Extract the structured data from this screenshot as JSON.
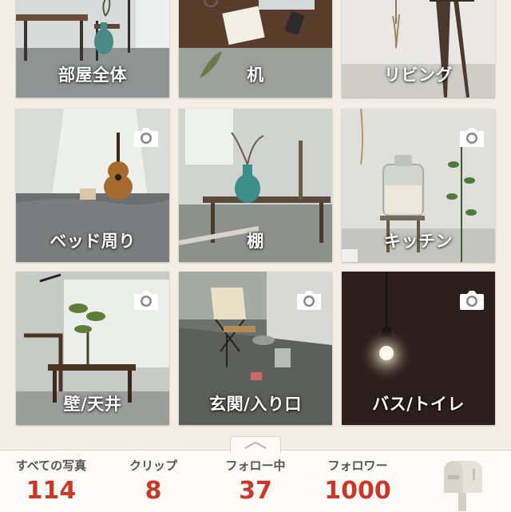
{
  "categories": [
    {
      "label": "部屋全体",
      "has_camera": false
    },
    {
      "label": "机",
      "has_camera": false
    },
    {
      "label": "リビング",
      "has_camera": false
    },
    {
      "label": "ベッド周り",
      "has_camera": true
    },
    {
      "label": "棚",
      "has_camera": false
    },
    {
      "label": "キッチン",
      "has_camera": true
    },
    {
      "label": "壁/天井",
      "has_camera": true
    },
    {
      "label": "玄関/入り口",
      "has_camera": true
    },
    {
      "label": "バス/トイレ",
      "has_camera": true
    }
  ],
  "stats": [
    {
      "label": "すべての写真",
      "value": "114"
    },
    {
      "label": "クリップ",
      "value": "8"
    },
    {
      "label": "フォロー中",
      "value": "37"
    },
    {
      "label": "フォロワー",
      "value": "1000"
    }
  ],
  "icons": {
    "camera": "camera-icon",
    "handle": "chevron-up-icon",
    "mailbox": "mailbox-icon"
  },
  "colors": {
    "background": "#f4efe6",
    "stat_value": "#c9392b",
    "stat_label": "#555555"
  }
}
